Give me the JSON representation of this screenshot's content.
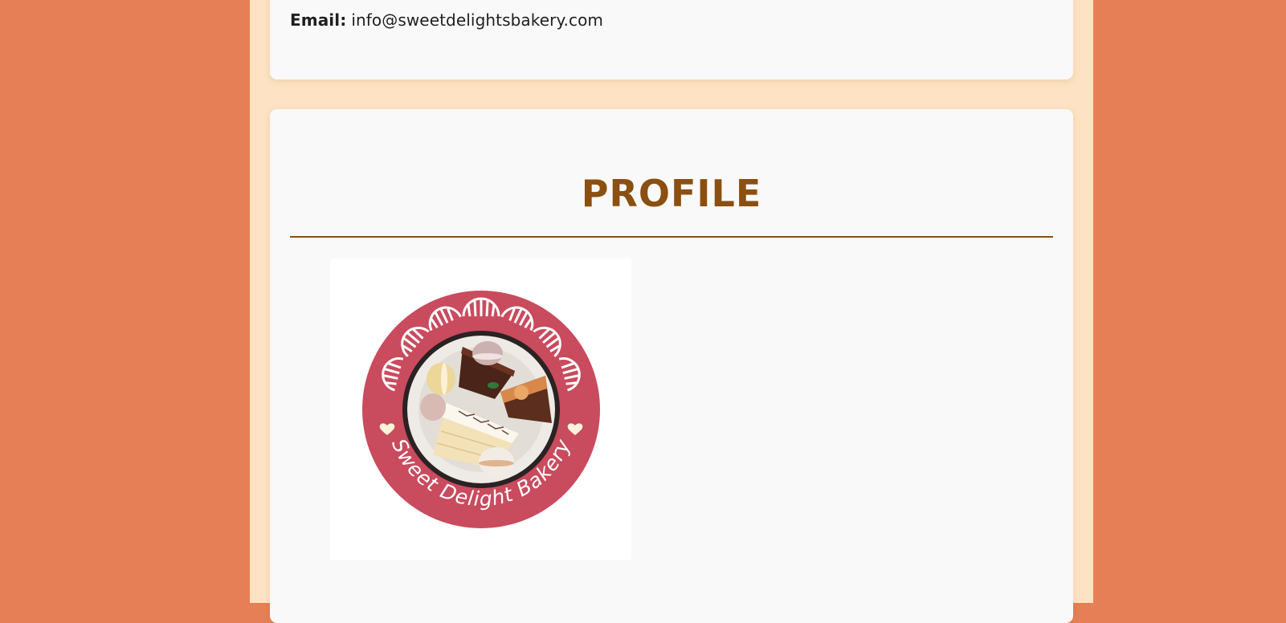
{
  "contact": {
    "email_label": "Email:",
    "email_value": "info@sweetdelightsbakery.com"
  },
  "profile": {
    "title": "PROFILE",
    "logo": {
      "icon": "bakery-logo",
      "text": "Sweet Delight Bakery",
      "ring_color": "#c94b5e",
      "background": "#ffffff"
    }
  },
  "colors": {
    "page_background": "#e67f55",
    "column_background": "#fde3c3",
    "card_background": "#f9f9f9",
    "heading": "#8b4f10"
  }
}
